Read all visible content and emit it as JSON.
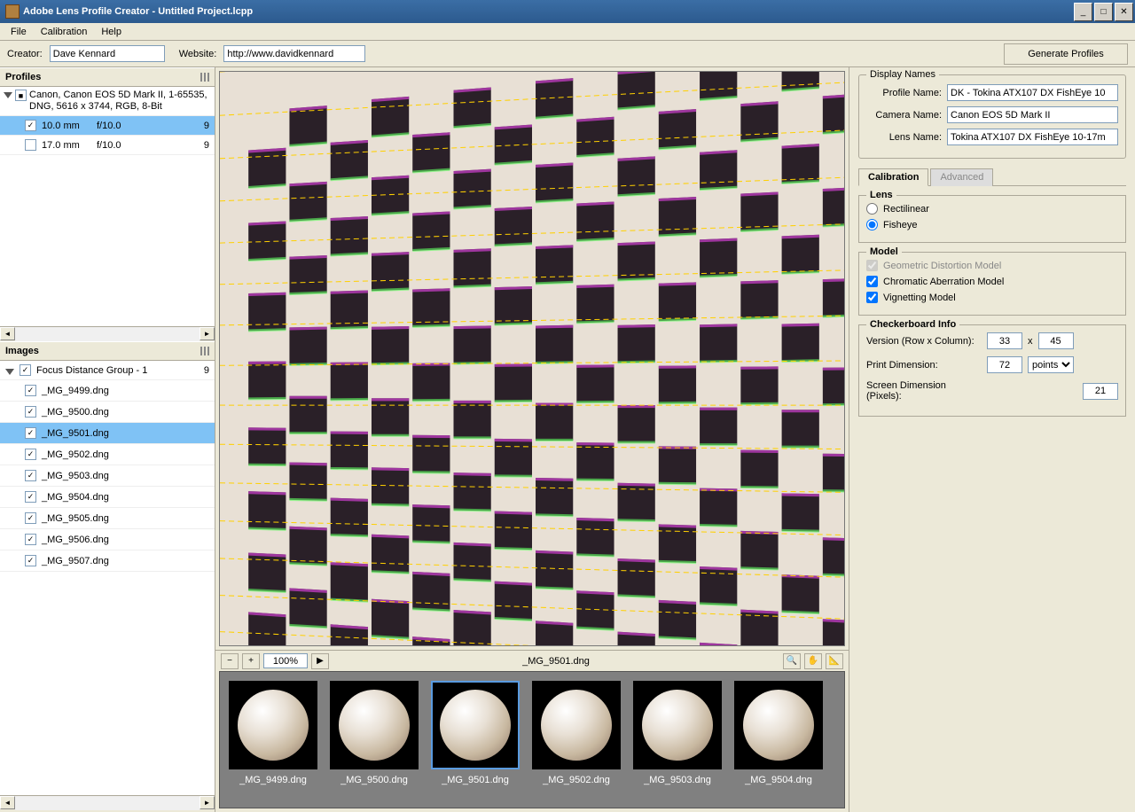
{
  "window": {
    "title": "Adobe Lens Profile Creator - Untitled Project.lcpp"
  },
  "menu": {
    "file": "File",
    "calibration": "Calibration",
    "help": "Help"
  },
  "toolbar": {
    "creator_label": "Creator:",
    "creator_value": "Dave Kennard",
    "website_label": "Website:",
    "website_value": "http://www.davidkennard",
    "generate": "Generate Profiles"
  },
  "profiles": {
    "title": "Profiles",
    "group": "Canon, Canon EOS 5D Mark II, 1-65535, DNG, 5616 x 3744, RGB, 8-Bit",
    "rows": [
      {
        "checked": true,
        "focal": "10.0 mm",
        "aperture": "f/10.0",
        "count": "9"
      },
      {
        "checked": false,
        "focal": "17.0 mm",
        "aperture": "f/10.0",
        "count": "9"
      }
    ]
  },
  "images": {
    "title": "Images",
    "group": "Focus Distance Group - 1",
    "group_count": "9",
    "list": [
      "_MG_9499.dng",
      "_MG_9500.dng",
      "_MG_9501.dng",
      "_MG_9502.dng",
      "_MG_9503.dng",
      "_MG_9504.dng",
      "_MG_9505.dng",
      "_MG_9506.dng",
      "_MG_9507.dng"
    ],
    "selected": "_MG_9501.dng"
  },
  "viewer": {
    "zoom": "100%",
    "filename": "_MG_9501.dng"
  },
  "filmstrip": [
    "_MG_9499.dng",
    "_MG_9500.dng",
    "_MG_9501.dng",
    "_MG_9502.dng",
    "_MG_9503.dng",
    "_MG_9504.dng"
  ],
  "display_names": {
    "title": "Display Names",
    "profile_label": "Profile Name:",
    "profile_value": "DK - Tokina ATX107 DX FishEye 10",
    "camera_label": "Camera Name:",
    "camera_value": "Canon EOS 5D Mark II",
    "lens_label": "Lens Name:",
    "lens_value": "Tokina ATX107 DX FishEye 10-17m"
  },
  "tabs": {
    "calibration": "Calibration",
    "advanced": "Advanced"
  },
  "lens": {
    "title": "Lens",
    "rectilinear": "Rectilinear",
    "fisheye": "Fisheye"
  },
  "model": {
    "title": "Model",
    "geom": "Geometric Distortion Model",
    "chroma": "Chromatic Aberration Model",
    "vignette": "Vignetting Model"
  },
  "checkerboard": {
    "title": "Checkerboard Info",
    "version_label": "Version (Row x Column):",
    "rows": "33",
    "cols": "45",
    "x": "x",
    "print_label": "Print Dimension:",
    "print_val": "72",
    "print_unit": "points",
    "screen_label": "Screen Dimension (Pixels):",
    "screen_val": "21"
  }
}
